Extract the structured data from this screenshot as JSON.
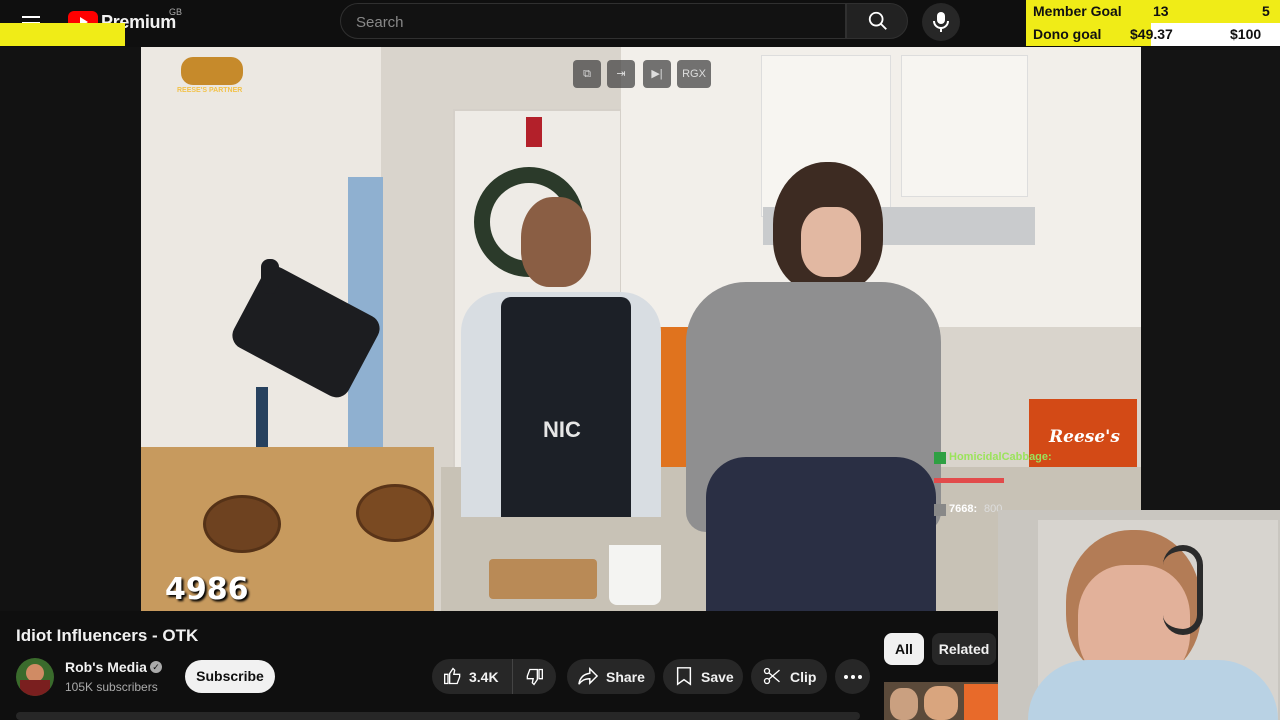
{
  "header": {
    "brand": "Premium",
    "country_code": "GB",
    "search_placeholder": "Search"
  },
  "goals": {
    "member_label": "Member Goal",
    "member_current": "13",
    "member_target": "5",
    "dono_label": "Dono goal",
    "dono_current": "$49.37",
    "dono_target": "$100",
    "dono_progress": 0.4937
  },
  "video": {
    "sponsor_badge": "REESE'S PARTNER",
    "counter": "4986",
    "controls": [
      "popout-icon",
      "exit-icon",
      "skip-icon"
    ],
    "rgx_label": "RGX",
    "box_text": "Reese's",
    "apron_text": "NIC",
    "chat": [
      {
        "user": "HomicidalCabbage:",
        "color": "#9be35b"
      },
      {
        "user": "7668:",
        "text": "800 ..."
      }
    ]
  },
  "info": {
    "title": "Idiot Influencers - OTK",
    "channel_name": "Rob's Media",
    "subscribers": "105K subscribers",
    "subscribe_label": "Subscribe",
    "likes": "3.4K",
    "share_label": "Share",
    "save_label": "Save",
    "clip_label": "Clip"
  },
  "chips": {
    "all": "All",
    "related": "Related"
  },
  "colors": {
    "accent_red": "#ff0000",
    "goal_yellow": "#f0ec17",
    "chat_name": "#9be35b"
  }
}
